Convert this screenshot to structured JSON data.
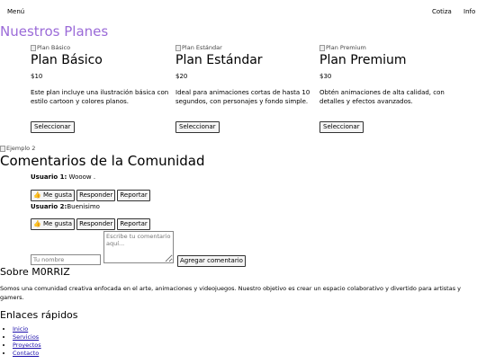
{
  "nav": {
    "menu": "Menú",
    "cotiza": "Cotiza",
    "info": "Info"
  },
  "plans": {
    "title": "Nuestros Planes",
    "items": [
      {
        "img_alt": "Plan Básico",
        "name": "Plan Básico",
        "price": "$10",
        "desc": "Este plan incluye una ilustración básica con estilo cartoon y colores planos.",
        "button": "Seleccionar"
      },
      {
        "img_alt": "Plan Estándar",
        "name": "Plan Estándar",
        "price": "$20",
        "desc": "Ideal para animaciones cortas de hasta 10 segundos, con personajes y fondo simple.",
        "button": "Seleccionar"
      },
      {
        "img_alt": "Plan Premium",
        "name": "Plan Premium",
        "price": "$30",
        "desc": "Obtén animaciones de alta calidad, con detalles y efectos avanzados.",
        "button": "Seleccionar"
      }
    ],
    "title_color": "#9b6bd8"
  },
  "example_img_alt": "Ejemplo 2",
  "comments": {
    "title": "Comentarios de la Comunidad",
    "items": [
      {
        "user": "Usuario 1:",
        "text": " Wooow ."
      },
      {
        "user": "Usuario 2:",
        "text": "Buenisimo"
      }
    ],
    "actions": {
      "like": "👍 Me gusta",
      "reply": "Responder",
      "report": "Reportar"
    },
    "form": {
      "name_placeholder": "Tu nombre",
      "comment_placeholder": "Escribe tu comentario aquí...",
      "submit": "Agregar comentario"
    }
  },
  "about": {
    "title": "Sobre M0RRIZ",
    "text": "Somos una comunidad creativa enfocada en el arte, animaciones y videojuegos. Nuestro objetivo es crear un espacio colaborativo y divertido para artistas y gamers."
  },
  "links": {
    "title": "Enlaces rápidos",
    "items": [
      "Inicio",
      "Servicios",
      "Proyectos",
      "Contacto"
    ]
  }
}
